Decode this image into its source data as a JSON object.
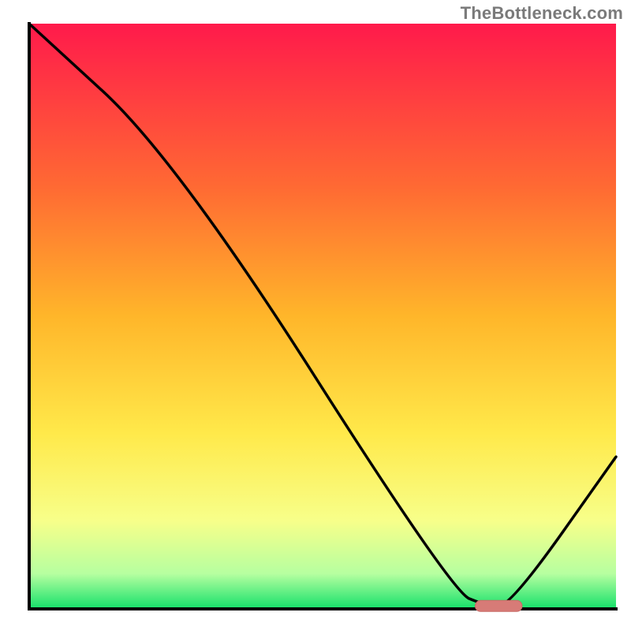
{
  "attribution": "TheBottleneck.com",
  "colors": {
    "gradient_top": "#ff1a4b",
    "gradient_mid_upper": "#ff6a33",
    "gradient_mid": "#ffb62a",
    "gradient_mid_lower": "#ffe94a",
    "gradient_lower": "#f7ff8a",
    "gradient_green_light": "#b6ffa0",
    "gradient_green": "#14e06a",
    "axis": "#000000",
    "curve": "#000000",
    "marker_fill": "#d77b77",
    "marker_stroke": "#c86a66"
  },
  "chart_data": {
    "type": "line",
    "title": "",
    "xlabel": "",
    "ylabel": "",
    "xlim": [
      0,
      100
    ],
    "ylim": [
      0,
      100
    ],
    "grid": false,
    "legend": false,
    "series": [
      {
        "name": "bottleneck-curve",
        "x": [
          0,
          25,
          72,
          78,
          82,
          100
        ],
        "values": [
          100,
          77,
          3,
          0.5,
          0.5,
          26
        ]
      }
    ],
    "marker": {
      "name": "optimal-range",
      "x_start": 76,
      "x_end": 84,
      "y": 0.5
    },
    "gradient_stops_pct": [
      {
        "offset": 0,
        "color": "#ff1a4b"
      },
      {
        "offset": 28,
        "color": "#ff6a33"
      },
      {
        "offset": 50,
        "color": "#ffb62a"
      },
      {
        "offset": 70,
        "color": "#ffe94a"
      },
      {
        "offset": 85,
        "color": "#f7ff8a"
      },
      {
        "offset": 94,
        "color": "#b6ffa0"
      },
      {
        "offset": 100,
        "color": "#14e06a"
      }
    ]
  }
}
